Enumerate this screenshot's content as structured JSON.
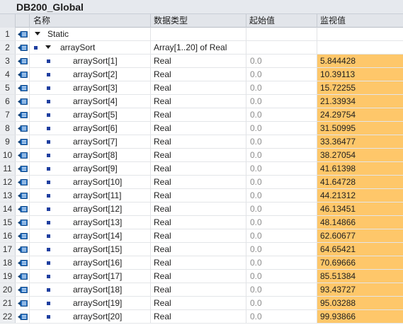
{
  "window": {
    "title": "DB200_Global"
  },
  "columns": {
    "name": "名称",
    "datatype": "数据类型",
    "start": "起始值",
    "monitor": "监视值"
  },
  "rows": [
    {
      "num": "1",
      "name": "Static",
      "level": 0,
      "expand": true,
      "bullet": false,
      "type": "",
      "start": "",
      "monitor": ""
    },
    {
      "num": "2",
      "name": "arraySort",
      "level": 1,
      "expand": true,
      "bullet": true,
      "type": "Array[1..20] of Real",
      "start": "",
      "monitor": ""
    },
    {
      "num": "3",
      "name": "arraySort[1]",
      "level": 2,
      "expand": false,
      "bullet": true,
      "type": "Real",
      "start": "0.0",
      "monitor": "5.844428"
    },
    {
      "num": "4",
      "name": "arraySort[2]",
      "level": 2,
      "expand": false,
      "bullet": true,
      "type": "Real",
      "start": "0.0",
      "monitor": "10.39113"
    },
    {
      "num": "5",
      "name": "arraySort[3]",
      "level": 2,
      "expand": false,
      "bullet": true,
      "type": "Real",
      "start": "0.0",
      "monitor": "15.72255"
    },
    {
      "num": "6",
      "name": "arraySort[4]",
      "level": 2,
      "expand": false,
      "bullet": true,
      "type": "Real",
      "start": "0.0",
      "monitor": "21.33934"
    },
    {
      "num": "7",
      "name": "arraySort[5]",
      "level": 2,
      "expand": false,
      "bullet": true,
      "type": "Real",
      "start": "0.0",
      "monitor": "24.29754"
    },
    {
      "num": "8",
      "name": "arraySort[6]",
      "level": 2,
      "expand": false,
      "bullet": true,
      "type": "Real",
      "start": "0.0",
      "monitor": "31.50995"
    },
    {
      "num": "9",
      "name": "arraySort[7]",
      "level": 2,
      "expand": false,
      "bullet": true,
      "type": "Real",
      "start": "0.0",
      "monitor": "33.36477"
    },
    {
      "num": "10",
      "name": "arraySort[8]",
      "level": 2,
      "expand": false,
      "bullet": true,
      "type": "Real",
      "start": "0.0",
      "monitor": "38.27054"
    },
    {
      "num": "11",
      "name": "arraySort[9]",
      "level": 2,
      "expand": false,
      "bullet": true,
      "type": "Real",
      "start": "0.0",
      "monitor": "41.61398"
    },
    {
      "num": "12",
      "name": "arraySort[10]",
      "level": 2,
      "expand": false,
      "bullet": true,
      "type": "Real",
      "start": "0.0",
      "monitor": "41.64728"
    },
    {
      "num": "13",
      "name": "arraySort[11]",
      "level": 2,
      "expand": false,
      "bullet": true,
      "type": "Real",
      "start": "0.0",
      "monitor": "44.21312"
    },
    {
      "num": "14",
      "name": "arraySort[12]",
      "level": 2,
      "expand": false,
      "bullet": true,
      "type": "Real",
      "start": "0.0",
      "monitor": "46.13451"
    },
    {
      "num": "15",
      "name": "arraySort[13]",
      "level": 2,
      "expand": false,
      "bullet": true,
      "type": "Real",
      "start": "0.0",
      "monitor": "48.14866"
    },
    {
      "num": "16",
      "name": "arraySort[14]",
      "level": 2,
      "expand": false,
      "bullet": true,
      "type": "Real",
      "start": "0.0",
      "monitor": "62.60677"
    },
    {
      "num": "17",
      "name": "arraySort[15]",
      "level": 2,
      "expand": false,
      "bullet": true,
      "type": "Real",
      "start": "0.0",
      "monitor": "64.65421"
    },
    {
      "num": "18",
      "name": "arraySort[16]",
      "level": 2,
      "expand": false,
      "bullet": true,
      "type": "Real",
      "start": "0.0",
      "monitor": "70.69666"
    },
    {
      "num": "19",
      "name": "arraySort[17]",
      "level": 2,
      "expand": false,
      "bullet": true,
      "type": "Real",
      "start": "0.0",
      "monitor": "85.51384"
    },
    {
      "num": "20",
      "name": "arraySort[18]",
      "level": 2,
      "expand": false,
      "bullet": true,
      "type": "Real",
      "start": "0.0",
      "monitor": "93.43727"
    },
    {
      "num": "21",
      "name": "arraySort[19]",
      "level": 2,
      "expand": false,
      "bullet": true,
      "type": "Real",
      "start": "0.0",
      "monitor": "95.03288"
    },
    {
      "num": "22",
      "name": "arraySort[20]",
      "level": 2,
      "expand": false,
      "bullet": true,
      "type": "Real",
      "start": "0.0",
      "monitor": "99.93866"
    }
  ],
  "colors": {
    "monitor_highlight": "#fec76a",
    "bullet": "#1f3fa0",
    "db_icon": "#1f6fc7"
  },
  "icons": {
    "row_icon": "db-interface-icon",
    "expand": "expand-arrow-icon",
    "bullet": "member-bullet-icon"
  }
}
